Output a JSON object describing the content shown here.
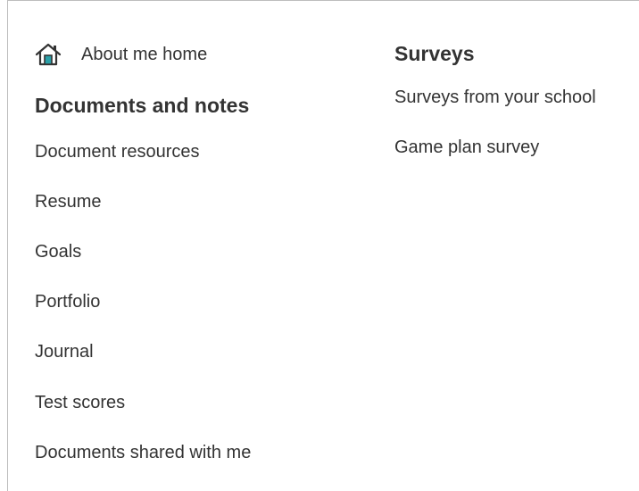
{
  "home": {
    "label": "About me home",
    "icon": "home-icon"
  },
  "documents": {
    "heading": "Documents and notes",
    "items": [
      "Document resources",
      "Resume",
      "Goals",
      "Portfolio",
      "Journal",
      "Test scores",
      "Documents shared with me"
    ]
  },
  "surveys": {
    "heading": "Surveys",
    "items": [
      "Surveys from your school",
      "Game plan survey"
    ]
  },
  "colors": {
    "text": "#333333",
    "icon_accent": "#2aa0a8",
    "border": "#bdbdbd"
  }
}
